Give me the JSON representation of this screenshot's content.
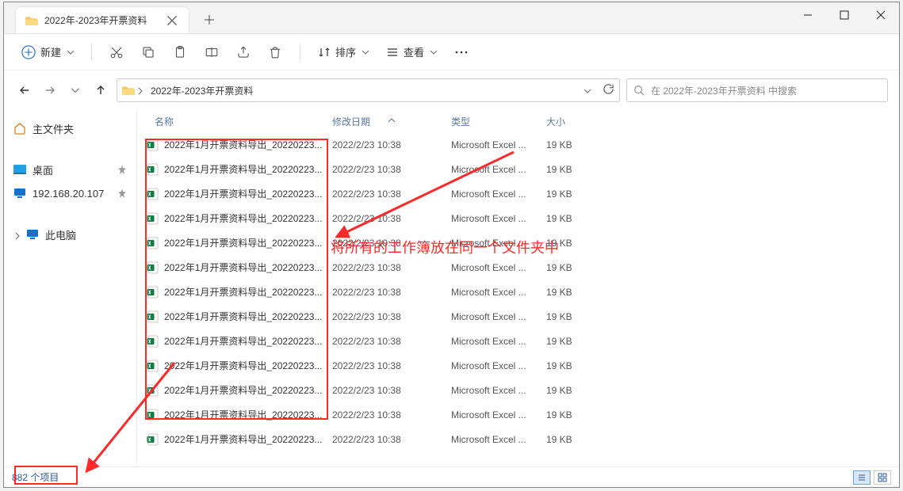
{
  "tab_title": "2022年-2023年开票资料",
  "toolbar": {
    "new_label": "新建",
    "sort_label": "排序",
    "view_label": "查看"
  },
  "breadcrumb": {
    "segments": [
      "2022年-2023年开票资料"
    ]
  },
  "search_placeholder": "在 2022年-2023年开票资料 中搜索",
  "sidebar": {
    "home": "主文件夹",
    "desktop": "桌面",
    "remote": "192.168.20.107",
    "thispc": "此电脑"
  },
  "columns": {
    "name": "名称",
    "date": "修改日期",
    "type": "类型",
    "size": "大小"
  },
  "files": [
    {
      "name": "2022年1月开票资料导出_20220223...",
      "date": "2022/2/23 10:38",
      "type": "Microsoft Excel ...",
      "size": "19 KB"
    },
    {
      "name": "2022年1月开票资料导出_20220223...",
      "date": "2022/2/23 10:38",
      "type": "Microsoft Excel ...",
      "size": "19 KB"
    },
    {
      "name": "2022年1月开票资料导出_20220223...",
      "date": "2022/2/23 10:38",
      "type": "Microsoft Excel ...",
      "size": "19 KB"
    },
    {
      "name": "2022年1月开票资料导出_20220223...",
      "date": "2022/2/23 10:38",
      "type": "Microsoft Excel ...",
      "size": "19 KB"
    },
    {
      "name": "2022年1月开票资料导出_20220223...",
      "date": "2022/2/23 10:38",
      "type": "Microsoft Excel ...",
      "size": "19 KB"
    },
    {
      "name": "2022年1月开票资料导出_20220223...",
      "date": "2022/2/23 10:38",
      "type": "Microsoft Excel ...",
      "size": "19 KB"
    },
    {
      "name": "2022年1月开票资料导出_20220223...",
      "date": "2022/2/23 10:38",
      "type": "Microsoft Excel ...",
      "size": "19 KB"
    },
    {
      "name": "2022年1月开票资料导出_20220223...",
      "date": "2022/2/23 10:38",
      "type": "Microsoft Excel ...",
      "size": "19 KB"
    },
    {
      "name": "2022年1月开票资料导出_20220223...",
      "date": "2022/2/23 10:38",
      "type": "Microsoft Excel ...",
      "size": "19 KB"
    },
    {
      "name": "2022年1月开票资料导出_20220223...",
      "date": "2022/2/23 10:38",
      "type": "Microsoft Excel ...",
      "size": "19 KB"
    },
    {
      "name": "2022年1月开票资料导出_20220223...",
      "date": "2022/2/23 10:38",
      "type": "Microsoft Excel ...",
      "size": "19 KB"
    },
    {
      "name": "2022年1月开票资料导出_20220223...",
      "date": "2022/2/23 10:38",
      "type": "Microsoft Excel ...",
      "size": "19 KB"
    },
    {
      "name": "2022年1月开票资料导出_20220223...",
      "date": "2022/2/23 10:38",
      "type": "Microsoft Excel ...",
      "size": "19 KB"
    }
  ],
  "status": {
    "item_count_text": "882 个项目"
  },
  "annotation_text": "将所有的工作簿放在同一个文件夹中"
}
